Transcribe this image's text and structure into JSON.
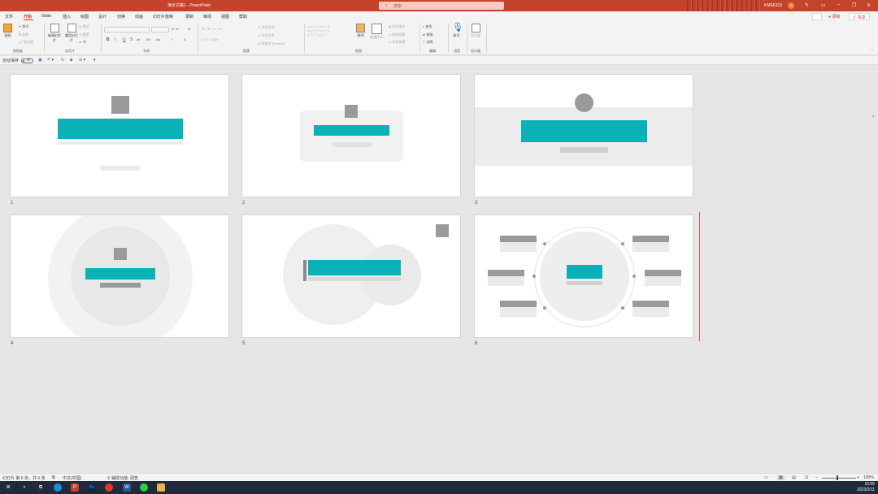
{
  "titlebar": {
    "title": "演示文稿1 - PowerPoint",
    "search_placeholder": "搜索",
    "user": "KMS6323",
    "avatar_initial": "K"
  },
  "tabs": [
    {
      "label": "文件"
    },
    {
      "label": "开始"
    },
    {
      "label": "iSlide"
    },
    {
      "label": "插入"
    },
    {
      "label": "绘图"
    },
    {
      "label": "设计"
    },
    {
      "label": "切换"
    },
    {
      "label": "动画"
    },
    {
      "label": "幻灯片放映"
    },
    {
      "label": "录制"
    },
    {
      "label": "审阅"
    },
    {
      "label": "视图"
    },
    {
      "label": "帮助"
    }
  ],
  "ribbon_right": {
    "record": "录制",
    "share": "共享"
  },
  "ribbon": {
    "clipboard": {
      "paste": "粘贴",
      "cut": "剪切",
      "copy": "复制",
      "format_painter": "格式刷",
      "group": "剪贴板"
    },
    "slides": {
      "new_slide": "新建幻灯片",
      "reuse": "重用幻灯片",
      "layout": "版式",
      "reset": "重置",
      "section": "节",
      "group": "幻灯片"
    },
    "font": {
      "group": "字体",
      "bold": "B",
      "italic": "I",
      "underline": "U",
      "strike": "S"
    },
    "paragraph": {
      "text_direction": "文字方向",
      "align_text": "对齐文本",
      "smartart": "转换为 SmartArt",
      "group": "段落"
    },
    "drawing": {
      "arrange": "排列",
      "quick_styles": "快速样式",
      "fill": "形状填充",
      "outline": "形状轮廓",
      "effects": "形状效果",
      "group": "绘图"
    },
    "editing": {
      "find": "查找",
      "replace": "替换",
      "select": "选择",
      "group": "编辑"
    },
    "voice": {
      "dictate": "听写",
      "group": "语音"
    },
    "designer": {
      "designer": "设计器",
      "group": "设计器"
    }
  },
  "qat": {
    "autosave": "自动保存",
    "toggle": "关"
  },
  "slides": [
    {
      "number": "1"
    },
    {
      "number": "2"
    },
    {
      "number": "3"
    },
    {
      "number": "4"
    },
    {
      "number": "5"
    },
    {
      "number": "6"
    }
  ],
  "statusbar": {
    "slide_info": "幻灯片 第 6 张，共 6 张",
    "language": "中文(中国)",
    "accessibility": "辅助功能: 调查",
    "zoom": "100%"
  },
  "taskbar": {
    "time": "15:06",
    "date": "2023/2/11"
  },
  "colors": {
    "accent": "#c4432b",
    "teal": "#0ab2b8"
  }
}
